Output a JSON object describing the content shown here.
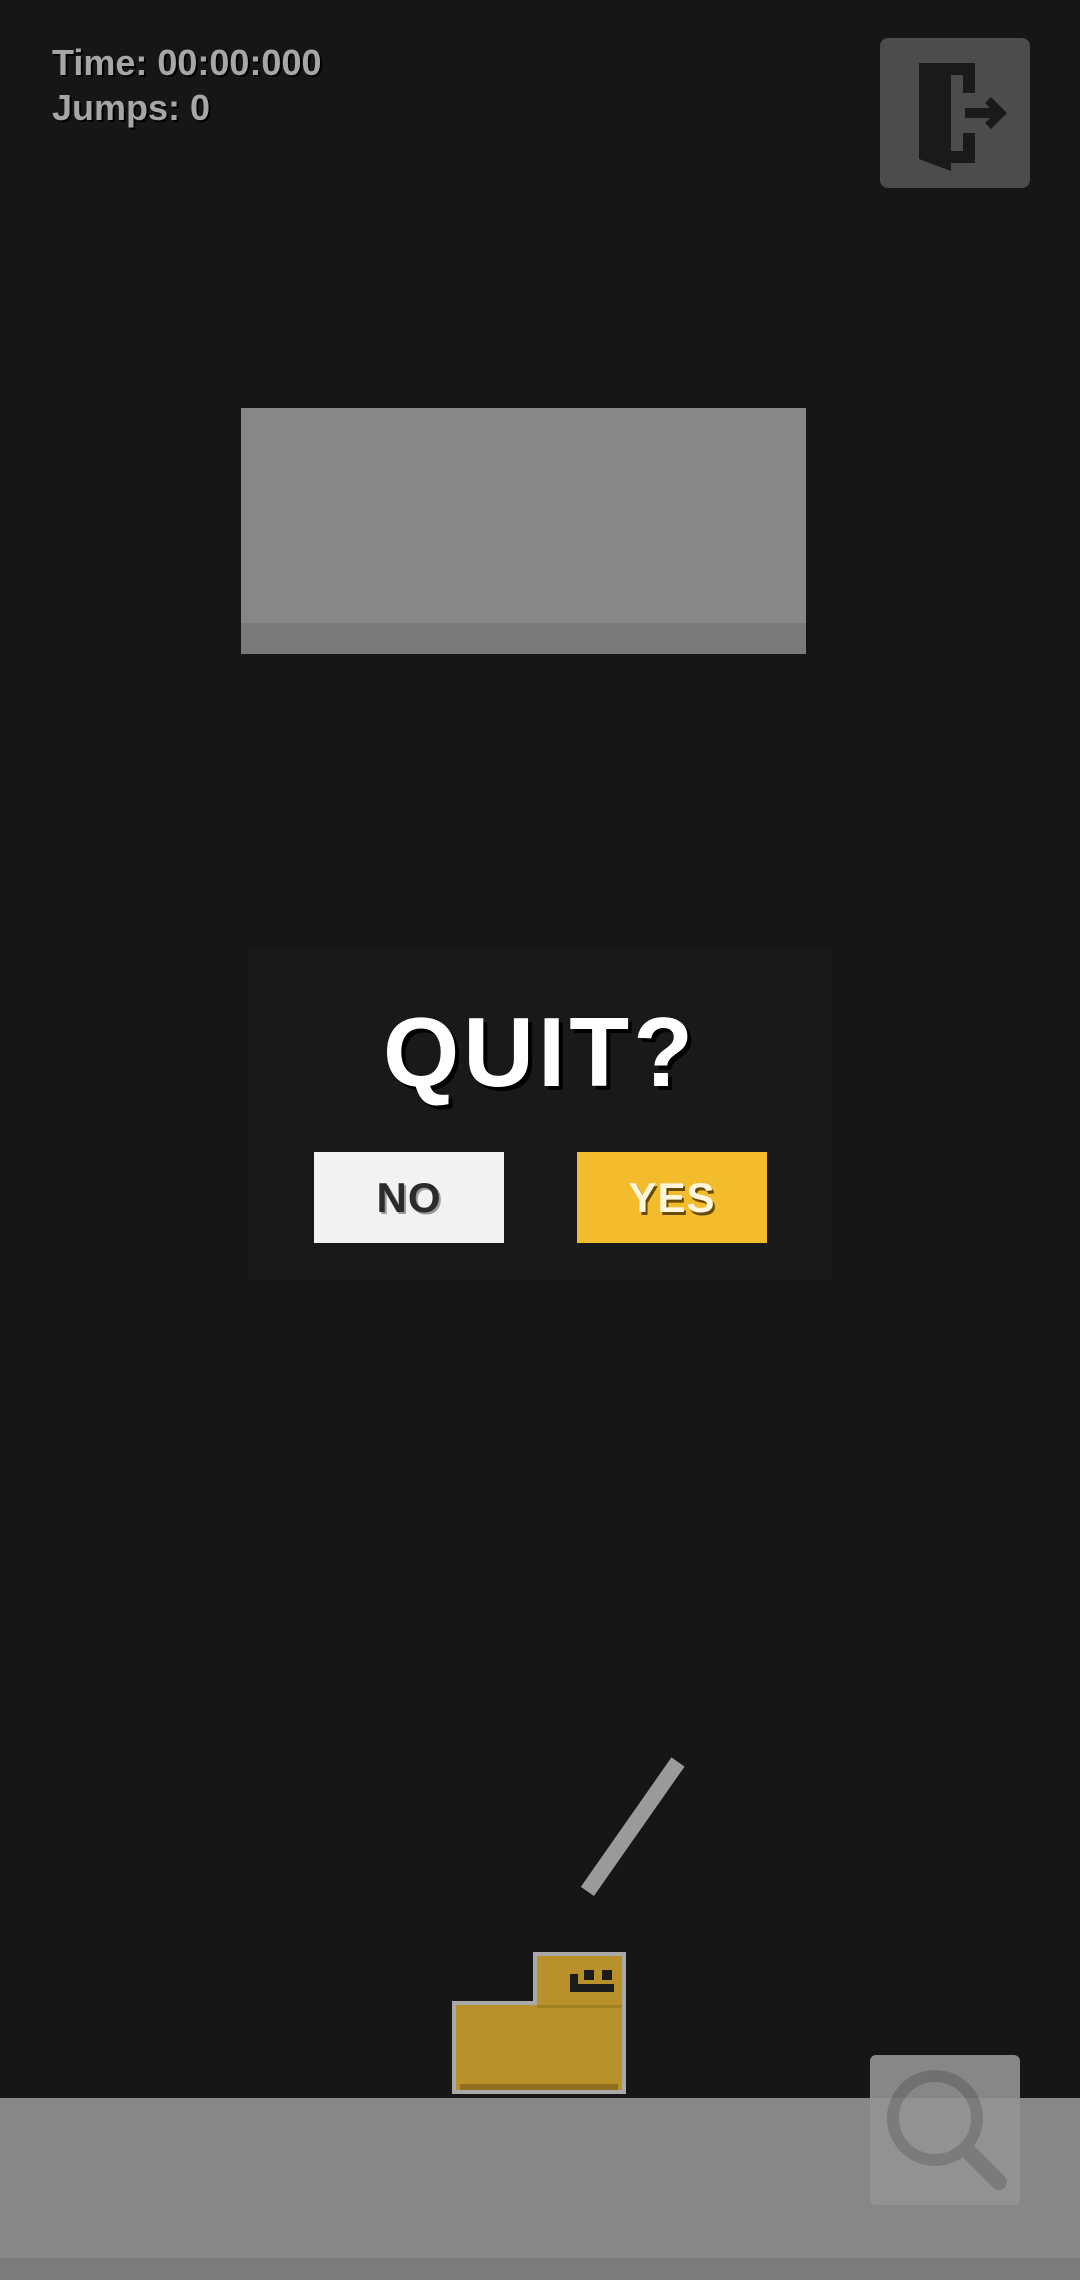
{
  "hud": {
    "time_label": "Time: 00:00:000",
    "jumps_label": "Jumps: 0"
  },
  "dialog": {
    "title": "QUIT?",
    "no_label": "NO",
    "yes_label": "YES"
  },
  "icons": {
    "exit": "exit-door-icon",
    "zoom": "magnifier-icon"
  },
  "colors": {
    "background": "#161616",
    "platform": "#878787",
    "yes_button": "#f2bc2c",
    "no_button": "#f2f2f2",
    "player": "#b8912a"
  }
}
